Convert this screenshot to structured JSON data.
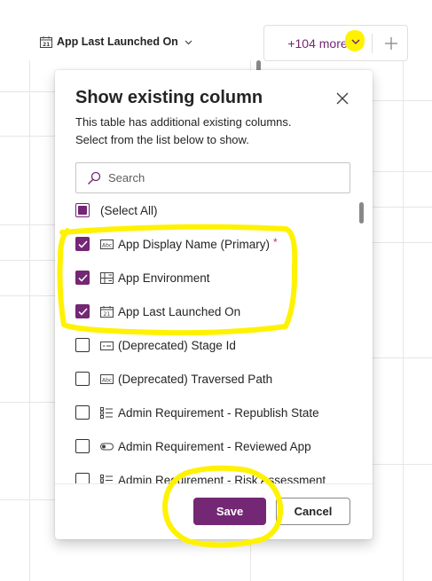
{
  "header": {
    "column_label": "App Last Launched On",
    "more_label": "+104 more",
    "add_label": "+"
  },
  "dialog": {
    "title": "Show existing column",
    "description_line1": "This table has additional existing columns.",
    "description_line2": "Select from the list below to show.",
    "search_placeholder": "Search",
    "items": [
      {
        "label": "(Select All)",
        "state": "partial",
        "icon": "none"
      },
      {
        "label": "App Display Name (Primary)",
        "required_mark": "*",
        "state": "checked",
        "icon": "text-field-icon"
      },
      {
        "label": "App Environment",
        "state": "checked",
        "icon": "lookup-field-icon"
      },
      {
        "label": "App Last Launched On",
        "state": "checked",
        "icon": "calendar-icon"
      },
      {
        "label": "(Deprecated) Stage Id",
        "state": "unchecked",
        "icon": "unique-id-icon"
      },
      {
        "label": "(Deprecated) Traversed Path",
        "state": "unchecked",
        "icon": "text-field-icon"
      },
      {
        "label": "Admin Requirement - Republish State",
        "state": "unchecked",
        "icon": "choice-list-icon"
      },
      {
        "label": "Admin Requirement - Reviewed App",
        "state": "unchecked",
        "icon": "toggle-icon"
      },
      {
        "label": "Admin Requirement - Risk Assessment",
        "state": "unchecked",
        "icon": "choice-list-icon"
      }
    ],
    "save_label": "Save",
    "cancel_label": "Cancel"
  },
  "colors": {
    "accent": "#742774",
    "highlight": "#fff200",
    "required": "#c4314b"
  }
}
